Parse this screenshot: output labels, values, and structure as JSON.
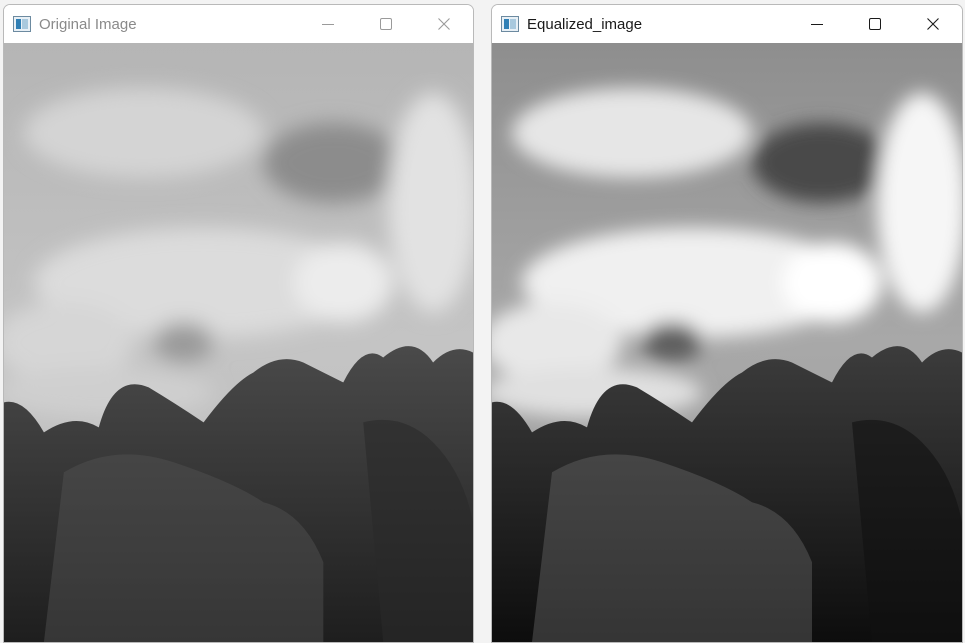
{
  "windows": [
    {
      "title": "Original Image",
      "icons": {
        "app": "opencv-window-icon",
        "min": "minimize-icon",
        "max": "maximize-icon",
        "close": "close-icon"
      },
      "image": "grayscale photo: cloudy sky above tree line, low contrast"
    },
    {
      "title": "Equalized_image",
      "icons": {
        "app": "opencv-window-icon",
        "min": "minimize-icon",
        "max": "maximize-icon",
        "close": "close-icon"
      },
      "image": "histogram-equalized photo: same scene, higher contrast"
    }
  ],
  "colors": {
    "desktop": "#f3f3f3",
    "titlebar": "#ffffff",
    "inactive_title": "#8a8a8a",
    "active_title": "#1a1a1a"
  }
}
